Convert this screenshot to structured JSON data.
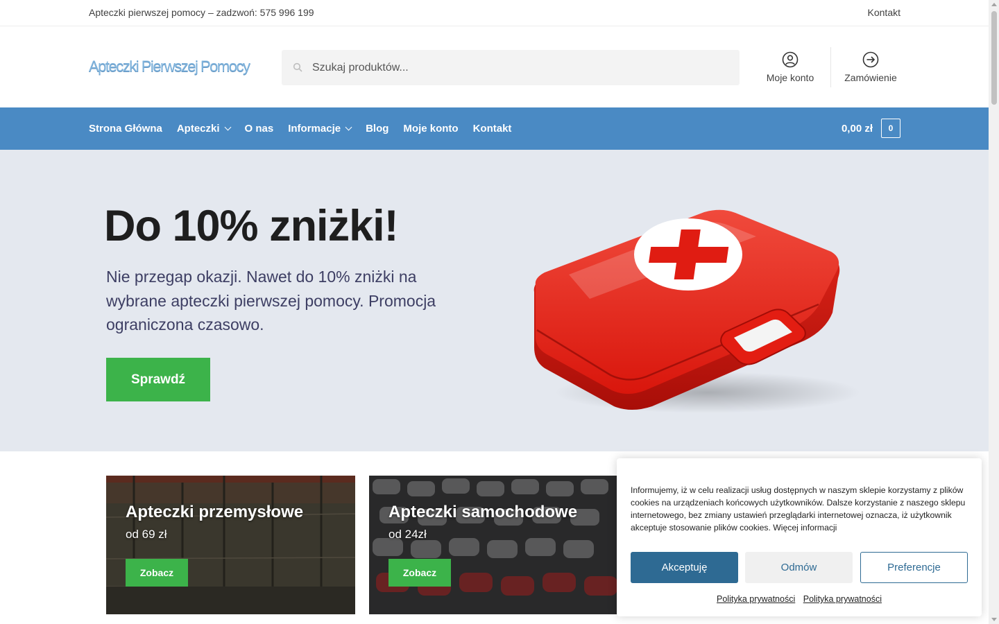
{
  "topbar": {
    "phone_text": "Apteczki pierwszej pomocy – zadzwoń: 575 996 199",
    "contact_label": "Kontakt"
  },
  "header": {
    "logo_text": "Apteczki Pierwszej Pomocy",
    "search_placeholder": "Szukaj produktów...",
    "account_label": "Moje konto",
    "order_label": "Zamówienie"
  },
  "nav": {
    "items": [
      {
        "label": "Strona Główna"
      },
      {
        "label": "Apteczki"
      },
      {
        "label": "O nas"
      },
      {
        "label": "Informacje"
      },
      {
        "label": "Blog"
      },
      {
        "label": "Moje konto"
      },
      {
        "label": "Kontakt"
      }
    ],
    "cart_total": "0,00 zł",
    "cart_count": "0"
  },
  "hero": {
    "headline": "Do 10% zniżki!",
    "text": "Nie przegap okazji. Nawet do 10% zniżki na wybrane apteczki pierwszej pomocy. Promocja ograniczona czasowo.",
    "cta_label": "Sprawdź"
  },
  "categories": [
    {
      "title": "Apteczki przemysłowe",
      "price": "od 69 zł",
      "button": "Zobacz"
    },
    {
      "title": "Apteczki samochodowe",
      "price": "od 24zł",
      "button": "Zobacz"
    }
  ],
  "cookie": {
    "message": "Informujemy, iż w celu realizacji usług dostępnych w naszym sklepie korzystamy z plików cookies na urządzeniach końcowych użytkowników. Dalsze korzystanie z naszego sklepu internetowego, bez zmiany ustawień przeglądarki internetowej oznacza, iż użytkownik akceptuje stosowanie plików cookies. Więcej informacji",
    "accept_label": "Akceptuję",
    "deny_label": "Odmów",
    "prefs_label": "Preferencje",
    "privacy_link_1": "Polityka prywatności",
    "privacy_link_2": "Polityka prywatności"
  },
  "colors": {
    "nav_bg": "#4a8ac4",
    "hero_bg": "#e4e8ef",
    "button_green": "#3cb34a",
    "cookie_blue": "#2e6a93"
  }
}
